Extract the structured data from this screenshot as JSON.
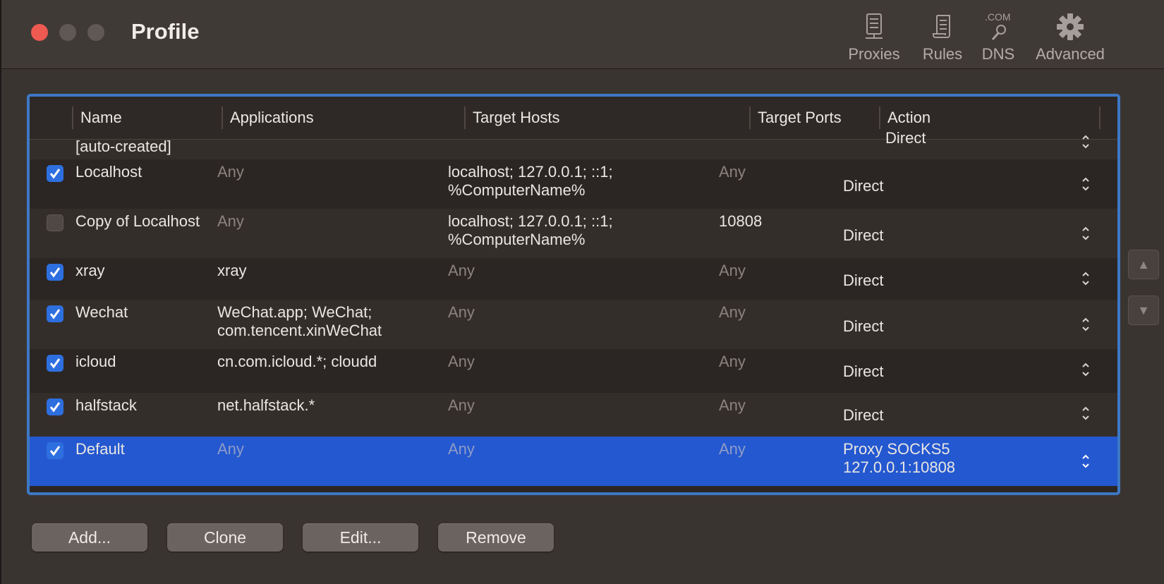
{
  "window": {
    "title": "Profile"
  },
  "toolbar": {
    "items": [
      {
        "label": "Proxies",
        "icon": "server-icon"
      },
      {
        "label": "Rules",
        "icon": "scroll-icon"
      },
      {
        "label": "DNS",
        "icon": "dns-search-icon",
        "icon_text": ".COM"
      },
      {
        "label": "Advanced",
        "icon": "gear-icon"
      }
    ]
  },
  "table": {
    "columns": [
      "Name",
      "Applications",
      "Target Hosts",
      "Target Ports",
      "Action"
    ],
    "partial_row": {
      "name": "[auto-created]",
      "action": "Direct"
    },
    "rows": [
      {
        "checked": true,
        "name": "Localhost",
        "applications": "Any",
        "hosts_line1": "localhost; 127.0.0.1; ::1;",
        "hosts_line2": "%ComputerName%",
        "ports": "Any",
        "action_line1": "Direct",
        "action_line2": ""
      },
      {
        "checked": false,
        "name": "Copy of Localhost",
        "applications": "Any",
        "hosts_line1": "localhost; 127.0.0.1; ::1;",
        "hosts_line2": "%ComputerName%",
        "ports": "10808",
        "action_line1": "Direct",
        "action_line2": ""
      },
      {
        "checked": true,
        "name": "xray",
        "applications": "xray",
        "hosts_line1": "Any",
        "hosts_line2": "",
        "ports": "Any",
        "action_line1": "Direct",
        "action_line2": ""
      },
      {
        "checked": true,
        "name": "Wechat",
        "applications": "WeChat.app; WeChat;",
        "applications_line2": "com.tencent.xinWeChat",
        "hosts_line1": "Any",
        "hosts_line2": "",
        "ports": "Any",
        "action_line1": "Direct",
        "action_line2": ""
      },
      {
        "checked": true,
        "name": "icloud",
        "applications": "cn.com.icloud.*; cloudd",
        "hosts_line1": "Any",
        "hosts_line2": "",
        "ports": "Any",
        "action_line1": "Direct",
        "action_line2": ""
      },
      {
        "checked": true,
        "name": "halfstack",
        "applications": "net.halfstack.*",
        "hosts_line1": "Any",
        "hosts_line2": "",
        "ports": "Any",
        "action_line1": "Direct",
        "action_line2": ""
      },
      {
        "checked": true,
        "name": "Default",
        "applications": "Any",
        "hosts_line1": "Any",
        "hosts_line2": "",
        "ports": "Any",
        "action_line1": "Proxy SOCKS5",
        "action_line2": "127.0.0.1:10808",
        "selected": true
      }
    ]
  },
  "order_buttons": {
    "up": "▲",
    "down": "▼"
  },
  "buttons": {
    "add": "Add...",
    "clone": "Clone",
    "edit": "Edit...",
    "remove": "Remove"
  },
  "colors": {
    "accent": "#2458d0",
    "frame": "#3d78c4",
    "close": "#ee5a52"
  }
}
